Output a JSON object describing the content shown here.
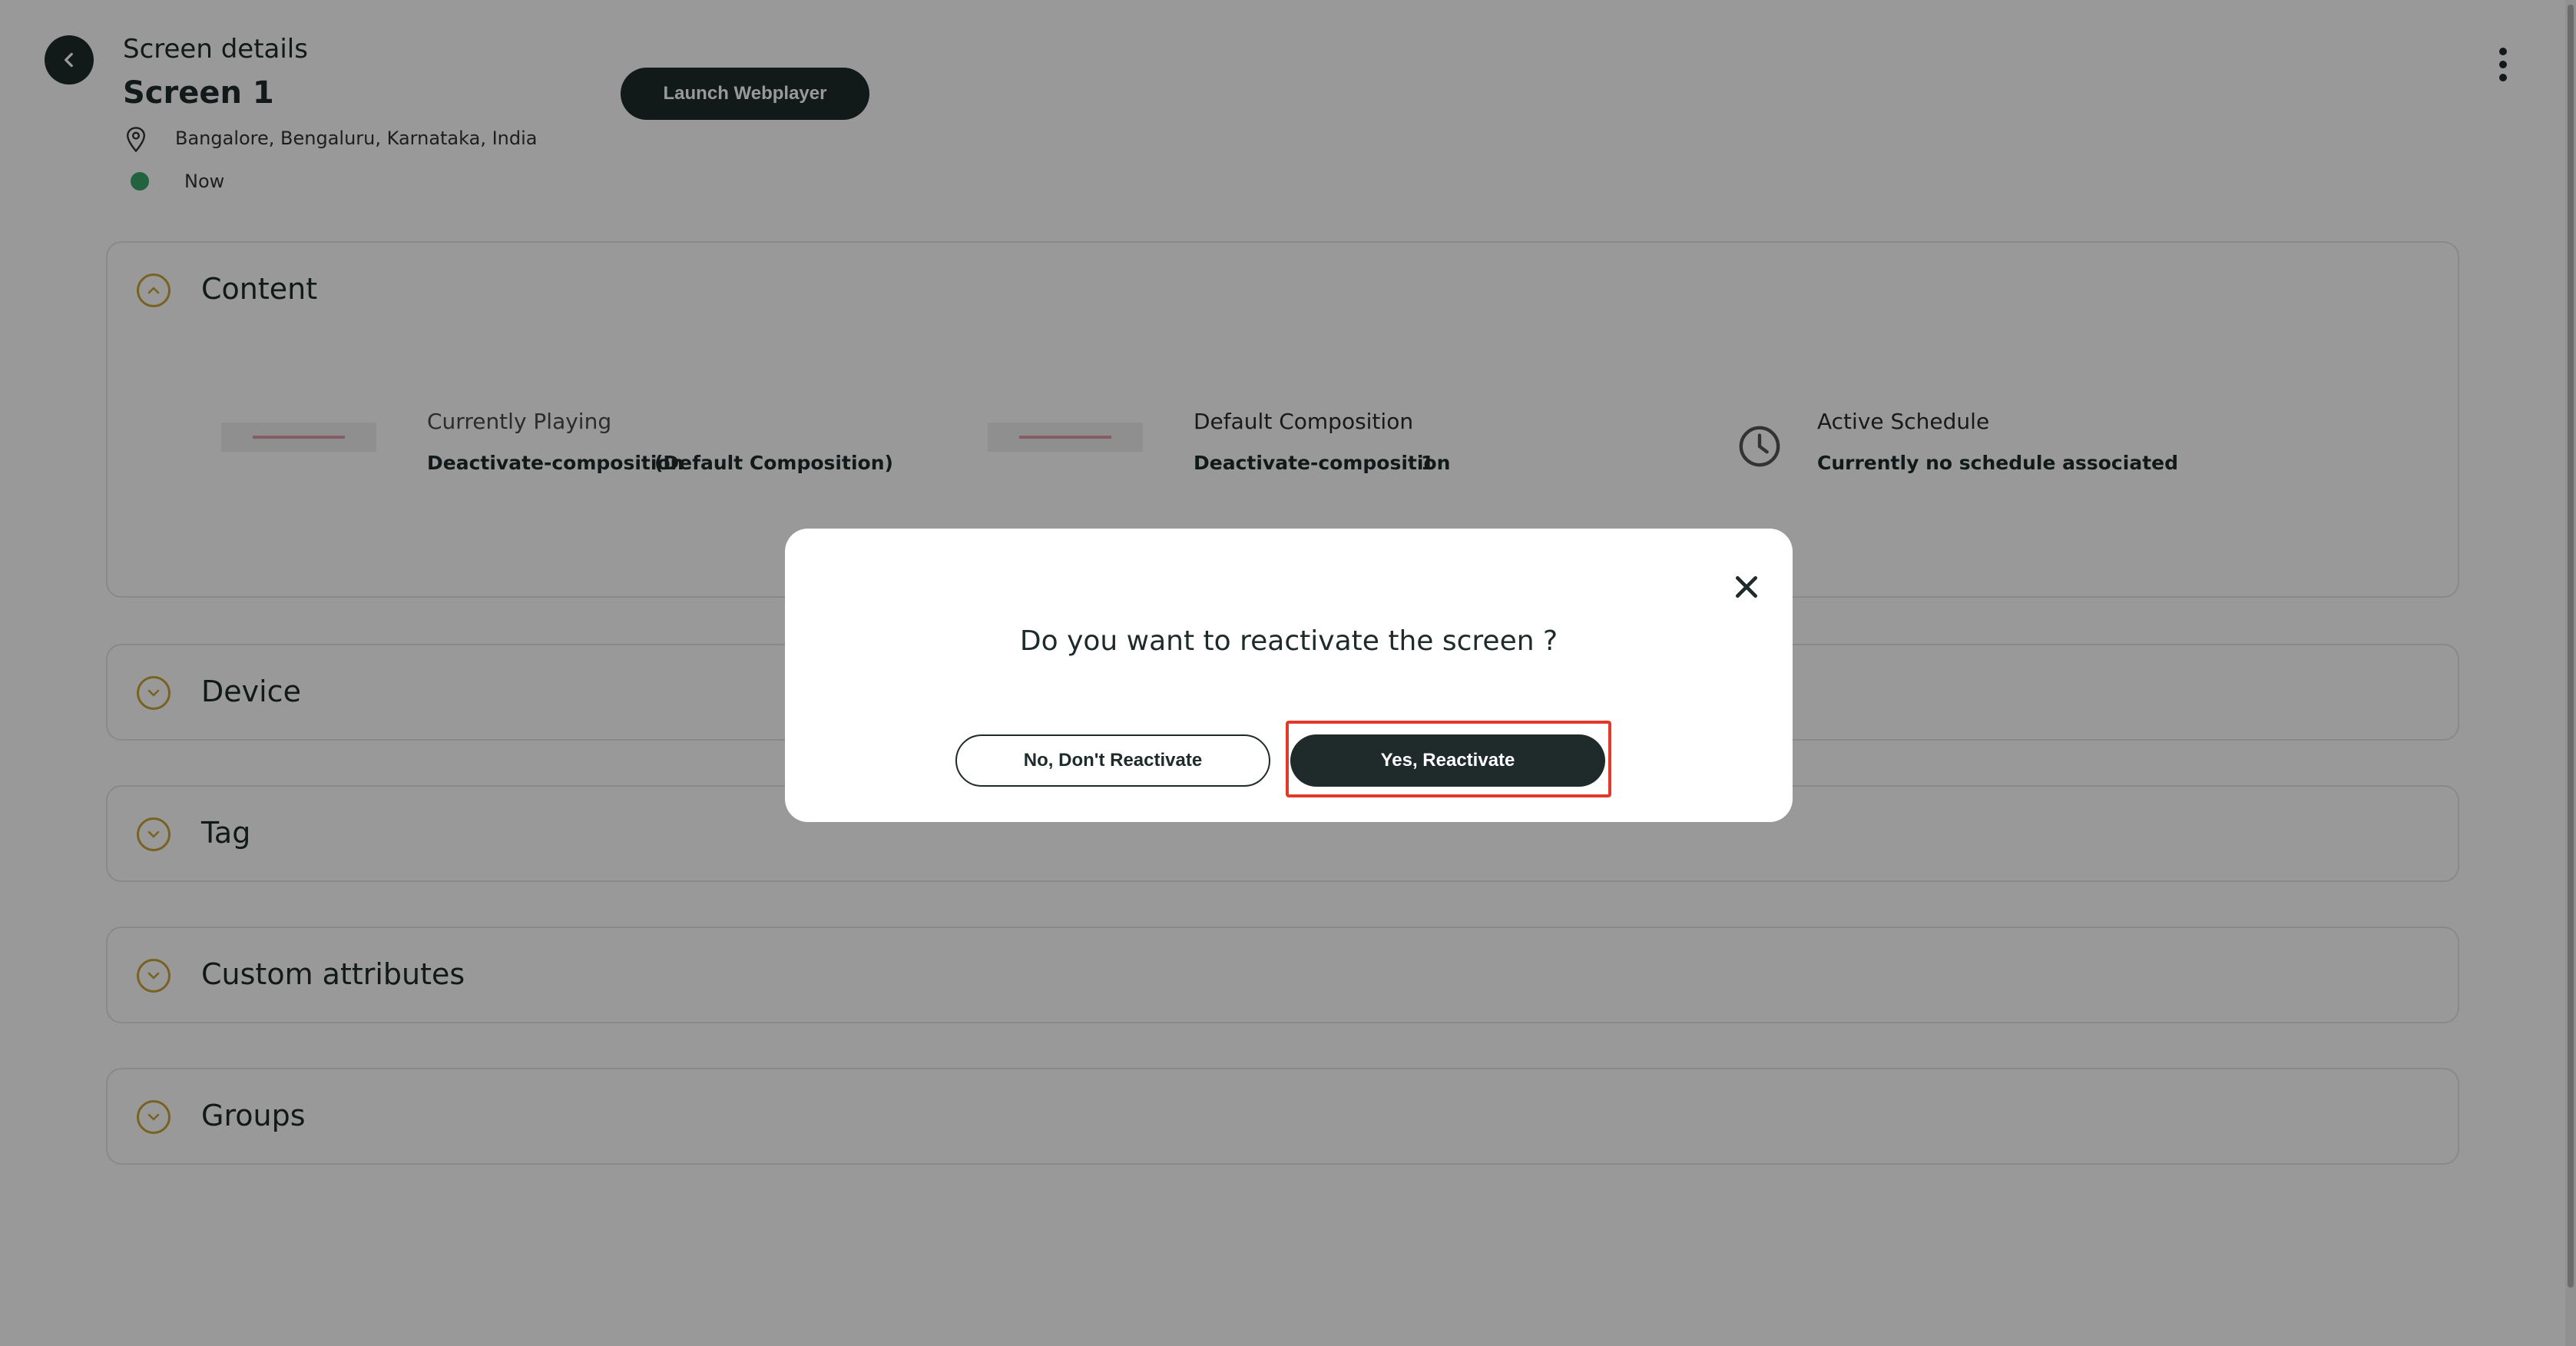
{
  "header": {
    "section_label": "Screen details",
    "screen_name": "Screen 1",
    "location": "Bangalore, Bengaluru, Karnataka, India",
    "status_text": "Now",
    "status_color": "#3aa36a",
    "launch_button": "Launch Webplayer",
    "icons": [
      "back-arrow-icon",
      "location-pin-icon",
      "kebab-menu-icon"
    ]
  },
  "sections": {
    "content": {
      "title": "Content",
      "expanded": true,
      "currently_playing": {
        "label": "Currently Playing",
        "name": "Deactivate-composition",
        "tag": "(Default Composition)"
      },
      "default_composition": {
        "label": "Default Composition",
        "name": "Deactivate-composition",
        "count": "1"
      },
      "active_schedule": {
        "label": "Active Schedule",
        "value": "Currently no schedule associated",
        "icon": "clock-icon"
      }
    },
    "device": {
      "title": "Device"
    },
    "tag": {
      "title": "Tag"
    },
    "custom_attributes": {
      "title": "Custom attributes"
    },
    "groups": {
      "title": "Groups"
    }
  },
  "modal": {
    "question": "Do you want to reactivate the screen ?",
    "cancel_button": "No, Don't Reactivate",
    "confirm_button": "Yes, Reactivate",
    "highlight_color": "#e23a2a",
    "close_icon": "close-icon"
  },
  "colors": {
    "primary_dark": "#1f2a2a",
    "accent_gold": "#c9a33a"
  }
}
